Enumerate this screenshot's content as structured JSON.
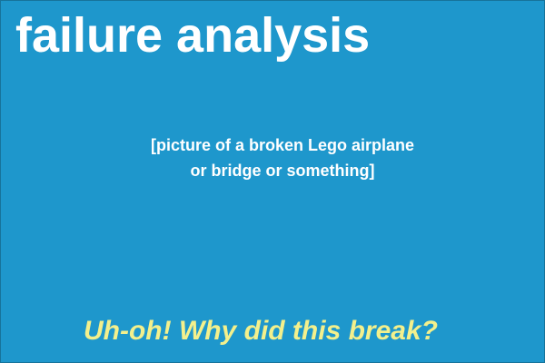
{
  "slide": {
    "title": "failure analysis",
    "placeholder_lines": [
      "[picture of a broken Lego airplane",
      "or bridge or something]"
    ],
    "tagline": "Uh-oh! Why did this break?"
  },
  "colors": {
    "background": "#1e97cc",
    "title_text": "#ffffff",
    "tagline_text": "#f3f08c"
  }
}
